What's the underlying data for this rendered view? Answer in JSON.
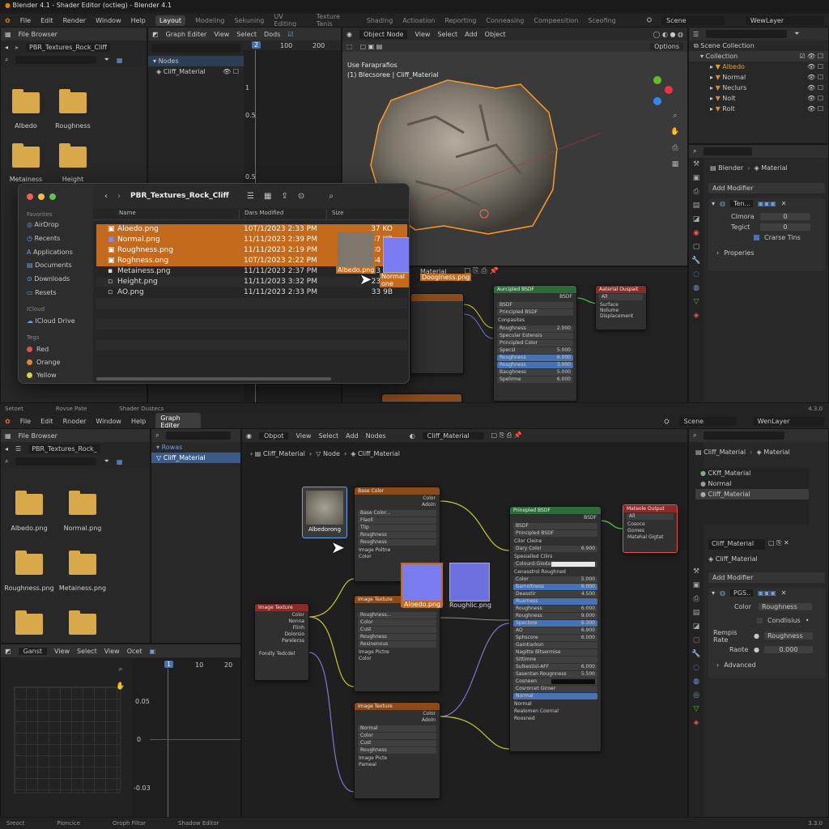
{
  "top": {
    "title_bar": "Blender 4.1 - Shader Editor (octieg) - Blender 4.1",
    "menu": [
      "File",
      "Edit",
      "Render",
      "Window",
      "Help"
    ],
    "workspaces": [
      "Layout",
      "Modeling",
      "Sekuning",
      "UV Editing",
      "Texture Tanis",
      "Shading",
      "Actioation",
      "Reporting",
      "Conneasing",
      "Compeesition",
      "Sceofing"
    ],
    "scene": "Scene",
    "view_layer": "WewLayer",
    "file_browser": {
      "title": "File Browser",
      "path": "PBR_Textures_Rock_Cliff",
      "items": [
        "Albedo",
        "Roughness",
        "Metainess",
        "Height",
        "AO"
      ]
    },
    "graph": {
      "header": [
        "Graph Editer",
        "View",
        "Select",
        "Dods"
      ],
      "tree": [
        "Nodes",
        "Cliff_Material"
      ],
      "ticks_x": [
        "2",
        "100",
        "200"
      ],
      "ticks_y": [
        "1",
        "0.5",
        "0.5"
      ]
    },
    "viewport": {
      "header": [
        "Object Node",
        "View",
        "Select",
        "Add",
        "Object"
      ],
      "label1": "Use Faraprafios",
      "label2": "(1) Blecsoree | Cliff_Material",
      "options": "Options"
    },
    "outliner": {
      "title": "Scene Collection",
      "collection": "Collection",
      "items": [
        {
          "name": "Albedo",
          "color": "#e0a040"
        },
        {
          "name": "Normal",
          "color": "#d08b40"
        },
        {
          "name": "Neclurs",
          "color": "#d08b40"
        },
        {
          "name": "Nolt",
          "color": "#d08b40"
        },
        {
          "name": "Rolt",
          "color": "#d08b40"
        }
      ]
    },
    "props": {
      "breadcrumb": [
        "Blender",
        "Material"
      ],
      "add_modifier": "Add Modifier",
      "mod_name": "Ten...",
      "fields": [
        {
          "label": "Clmora",
          "value": "0"
        },
        {
          "label": "Tegict",
          "value": "0"
        }
      ],
      "checkbox": "Crarse Tins",
      "properties": "Properies"
    },
    "status": [
      "Setoet",
      "Rovse Pate",
      "Shader Dustecs"
    ],
    "version": "4.3.0",
    "material_tab": "Material"
  },
  "finder": {
    "path": "PBR_Textures_Rock_Cliff",
    "sidebar_sections": [
      {
        "title": "Favorites",
        "items": [
          "AirDrop",
          "Recents",
          "Applications",
          "Documents",
          "Downloads",
          "Resets"
        ]
      },
      {
        "title": "ICloud",
        "items": [
          "ICloud Drive"
        ]
      },
      {
        "title": "Tegs",
        "items": [
          "Red",
          "Orange",
          "Yellow"
        ]
      }
    ],
    "tag_colors": [
      "#e05050",
      "#e08a30",
      "#e0d040"
    ],
    "columns": [
      "Name",
      "Dars Modified",
      "Size"
    ],
    "files": [
      {
        "name": "Aloedo.png",
        "date": "10T/1/2023 2:33 PM",
        "size": "37 KO",
        "selected": true
      },
      {
        "name": "Normal.png",
        "date": "11/11/2023 2:39 PM",
        "size": "37 KB",
        "selected": true
      },
      {
        "name": "Roughness.png",
        "date": "11/11/2023 2:19 PM",
        "size": "30 KB",
        "selected": true
      },
      {
        "name": "Roghness.ong",
        "date": "10T/1/2023 2:22 PM",
        "size": "34 KB",
        "selected": true
      },
      {
        "name": "Metainess.png",
        "date": "11/11/2023 2:37 PM",
        "size": "33 KB",
        "selected": false
      },
      {
        "name": "Height.png",
        "date": "11/11/2023 3:32 PM",
        "size": "23 KB",
        "selected": false
      },
      {
        "name": "AO.png",
        "date": "11/11/2023 2:33 PM",
        "size": "33 9B",
        "selected": false
      }
    ],
    "drag_labels": [
      "Albedo.png",
      "Normal one",
      "Dooglness.png"
    ]
  },
  "bottom": {
    "menu": [
      "File",
      "Edit",
      "Rnoder",
      "Window",
      "Help"
    ],
    "workspace": "Graph Editer",
    "scene": "Scene",
    "view_layer": "WenLayer",
    "file_browser": {
      "title": "File Browser",
      "path": "PBR_Textures_Rock_",
      "items": [
        "Albedo.png",
        "Normal.png",
        "Roughness.png",
        "Metainess.png"
      ]
    },
    "tree": [
      "Rowas",
      "Cliff_Material"
    ],
    "node_editor": {
      "header": [
        "Obpot",
        "View",
        "Select",
        "Add",
        "Nodes"
      ],
      "material": "Cliff_Material",
      "breadcrumb": [
        "Cliff_Material",
        "Node",
        "Cliff_Material"
      ],
      "drag_label": "Albedorong",
      "thumb_labels": [
        "Aloedo.png",
        "Roughlic.png"
      ]
    },
    "graph": {
      "header": [
        "Ganst",
        "View",
        "Select",
        "View",
        "Ocet"
      ],
      "ticks_x": [
        "1",
        "10",
        "20"
      ],
      "ticks_y": [
        "0.05",
        "0",
        "-0.03"
      ]
    },
    "props": {
      "header": [
        "Cliff_Material",
        "Material"
      ],
      "materials": [
        "CKff_Material",
        "Normal",
        "Cliff_Material"
      ],
      "slot": "Cliff_Material",
      "name": "Cliff_Material",
      "add_modifier": "Add Modifier",
      "mod_name": "PGS..",
      "color_label": "Color",
      "color_value": "Roughness",
      "checkbox": "Condlisius",
      "rows": [
        {
          "label": "Rempis Rate",
          "value": "Roughness"
        },
        {
          "label": "Raote",
          "value": "0.000"
        }
      ],
      "advanced": "Advanced"
    },
    "status": [
      "Sreoct",
      "Pioncice",
      "Oroph Filtar",
      "Shadow Editor"
    ],
    "version": "3.3.0"
  },
  "nodes": {
    "principled_top": {
      "title": "Aurcipled BSDF",
      "rows": [
        "BSDF",
        "BSDF",
        "Principled BSDF",
        "Conpasites",
        "Roughness",
        "Specular Estensis",
        "Principled Color",
        "Specsl",
        "Roughness",
        "Roughness",
        "Baughness",
        "Spelirme",
        "Fuscomeness"
      ],
      "values": [
        "2.000",
        "5.000",
        "6.000",
        "3.000",
        "5.000",
        "6.000"
      ]
    },
    "output_top": {
      "title": "Aaterial Ouspait",
      "rows": [
        "All",
        "Surface",
        "Nolume",
        "Displacement"
      ]
    },
    "base_color": {
      "title": "Base Color",
      "rows": [
        "Color",
        "Adoln",
        "Base Color...",
        "Flaoll",
        "Tlip",
        "Roughness",
        "Roughness",
        "Image Poltne",
        "Color"
      ]
    },
    "image_texture": {
      "title": "Image Texture",
      "rows": [
        "Color",
        "Nonna",
        "Flinh",
        "Dolorsio",
        "Parelecss",
        "Fondly Tedcdel"
      ]
    },
    "tex2": {
      "title": "Image Texture",
      "rows": [
        "Adoln",
        "Roughness...",
        "Color",
        "Cust",
        "Roughness",
        "Resinenous",
        "Image Pictre",
        "Color"
      ]
    },
    "tex3": {
      "title": "Image Texture",
      "rows": [
        "Color",
        "Adoln",
        "Normal",
        "Color",
        "Cust",
        "Roughness",
        "Image Picte",
        "Pameal"
      ]
    },
    "principled_bottom": {
      "title": "Prinopled BSDF",
      "rows": [
        "BSDF",
        "BSDF",
        "Principled BSDF",
        "Cilor Cleine",
        "Dary Color",
        "Spesialled Cilirs",
        "Colourd-Gioda",
        "Cenasstrol Roughned",
        "Color",
        "Bamoltness",
        "Deasstir",
        "Ruarness",
        "Roughness",
        "Roughness",
        "Spectore",
        "AO",
        "Sphscore",
        "Gaintiarkon",
        "Nagitte Bltsermise",
        "Sittimne",
        "Sulkestisl-AFF",
        "Sasentan Rougnness",
        "Cosneen",
        "Cosrorcet Giroer",
        "Normal",
        "Normal",
        "Realomen Coornal",
        "Roosned"
      ],
      "values": [
        "6.900",
        "5.000",
        "6.000",
        "4.500",
        "6.000",
        "9.000",
        "6.300",
        "6.900",
        "6.000",
        "6.000",
        "5.500"
      ]
    },
    "output_bottom": {
      "title": "Mateole Output",
      "rows": [
        "All",
        "Cosoce",
        "Gomes",
        "Matehal Gigtat"
      ]
    }
  }
}
